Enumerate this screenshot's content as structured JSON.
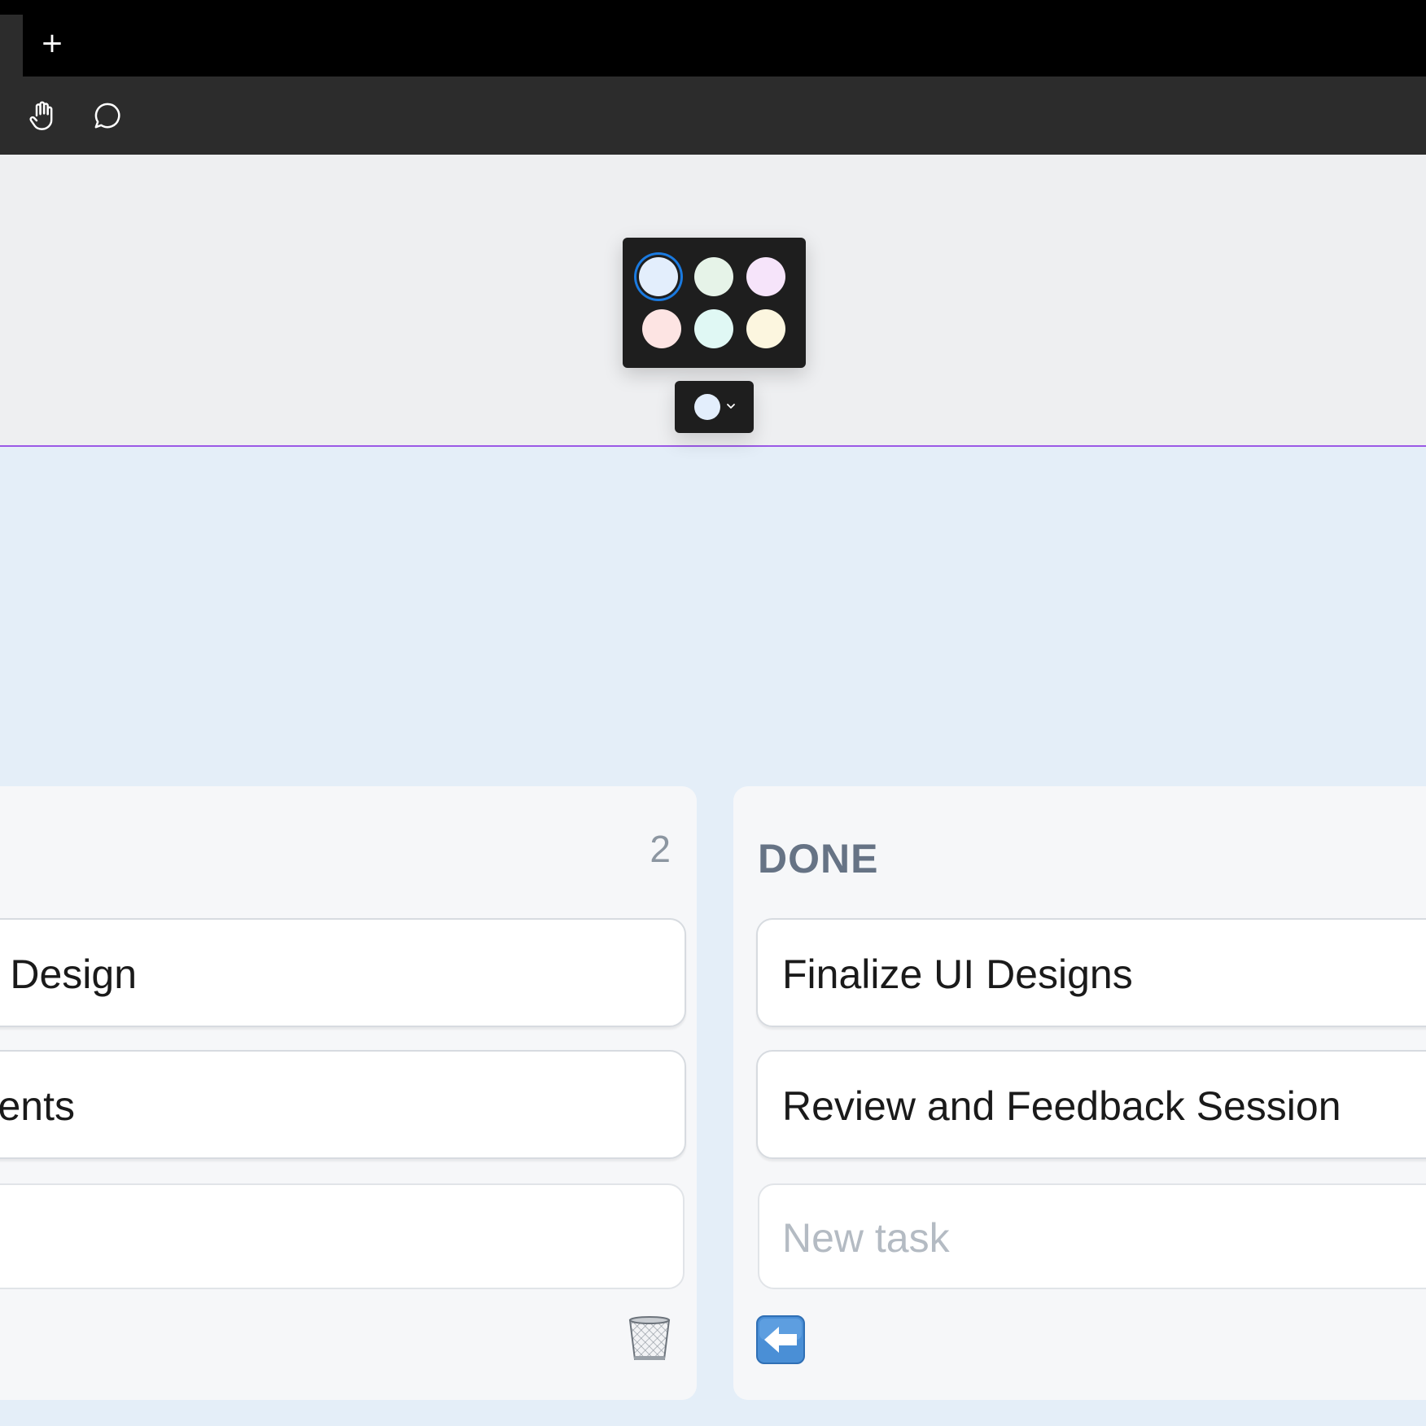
{
  "tabbar": {
    "new_tab_label": "+"
  },
  "toolbar": {
    "tools": [
      {
        "icon": "hand-icon"
      },
      {
        "icon": "comment-icon"
      }
    ]
  },
  "color_picker": {
    "swatches": [
      "#e3eefc",
      "#e6f3e8",
      "#f6e4fa",
      "#fde4e3",
      "#e0f8f4",
      "#fcf6df"
    ],
    "selected_index": 0,
    "selected_color": "#e3eefc",
    "selection_ring_color": "#1a7ae0"
  },
  "board": {
    "section_divider_color": "#9b59e6",
    "columns": [
      {
        "title": "",
        "count": "2",
        "cards": [
          {
            "text": "Design"
          },
          {
            "text": "ents"
          }
        ],
        "new_task_placeholder": "",
        "action_icon": "trash-icon"
      },
      {
        "title": "DONE",
        "count": "",
        "cards": [
          {
            "text": "Finalize UI Designs"
          },
          {
            "text": "Review and Feedback Session"
          }
        ],
        "new_task_placeholder": "New task",
        "action_icon": "left-arrow-icon"
      }
    ]
  }
}
